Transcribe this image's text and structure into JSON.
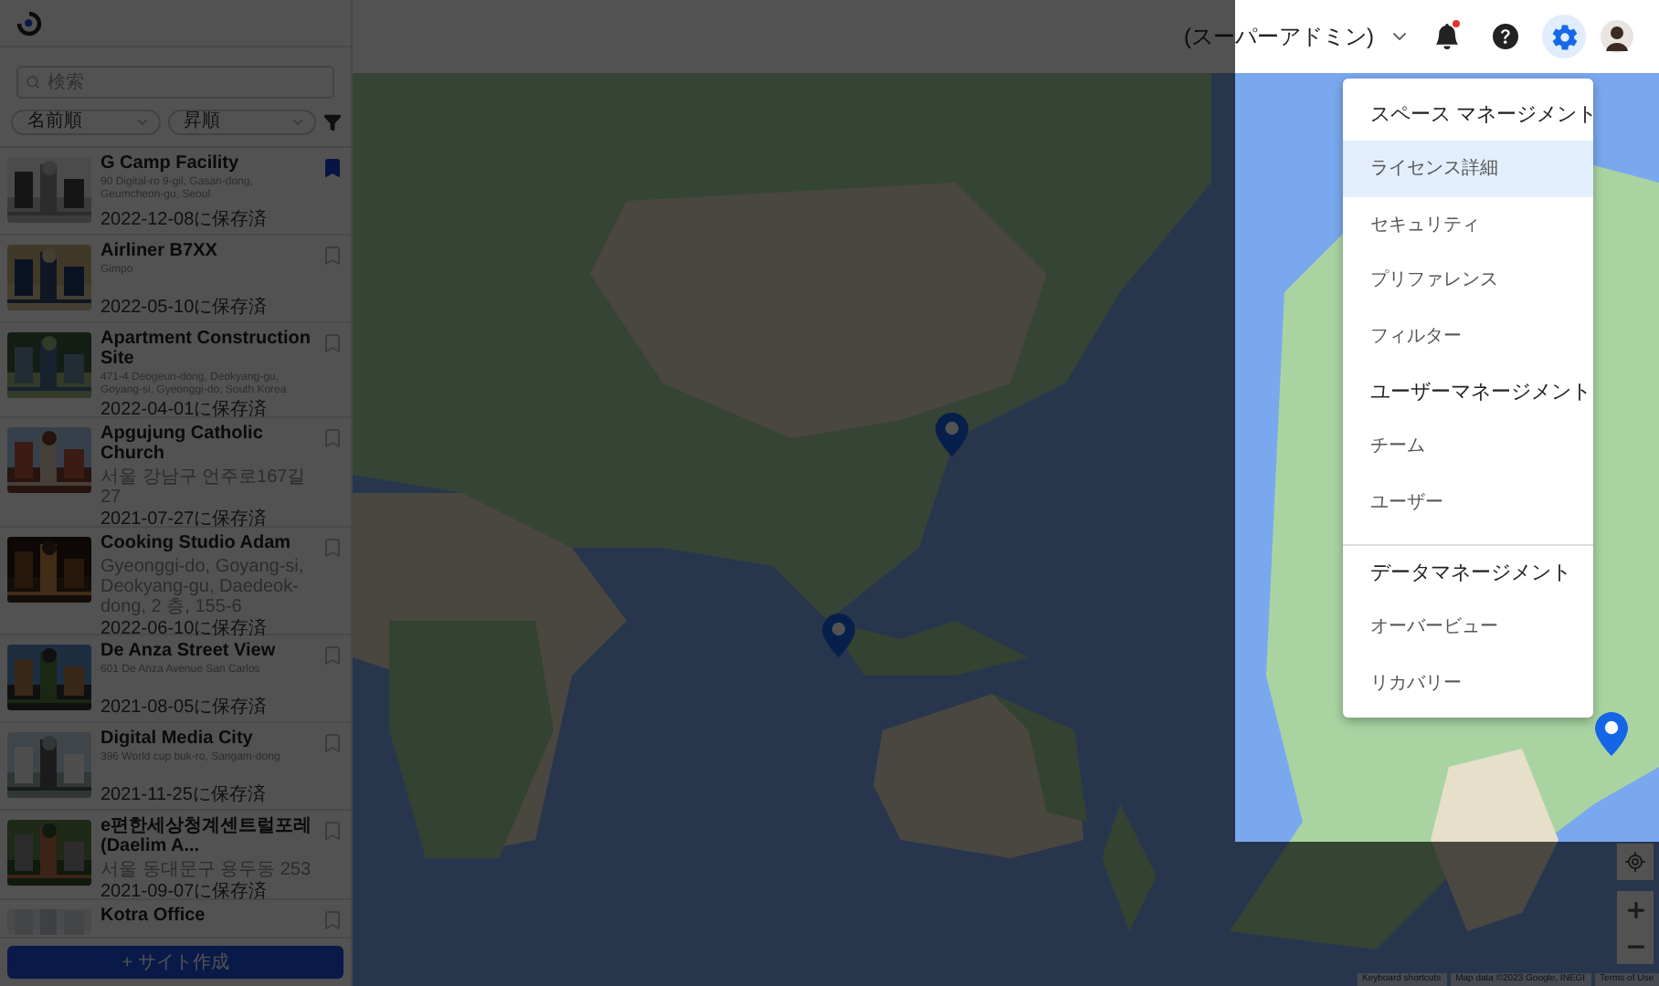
{
  "sidebar": {
    "search": {
      "placeholder": "検索"
    },
    "filters": [
      {
        "label": "名前順"
      },
      {
        "label": "昇順"
      }
    ],
    "sites": [
      {
        "title": "G Camp Facility",
        "address": "90 Digital-ro 9-gil, Gasan-dong, Geumcheon-gu, Seoul",
        "date": "2022-12-08に保存済",
        "bookmarked": true
      },
      {
        "title": "Airliner B7XX",
        "address": "Gimpo",
        "date": "2022-05-10に保存済",
        "bookmarked": false
      },
      {
        "title": "Apartment Construction Site",
        "address": "471-4 Deogeun-dong, Deokyang-gu, Goyang-si, Gyeonggi-do, South Korea",
        "date": "2022-04-01に保存済",
        "bookmarked": false
      },
      {
        "title": "Apgujung Catholic Church",
        "address": "서울 강남구 언주로167길 27",
        "date": "2021-07-27に保存済",
        "bookmarked": false
      },
      {
        "title": "Cooking Studio Adam",
        "address": "Gyeonggi-do, Goyang-si, Deokyang-gu, Daedeok-dong, 2 층, 155-6",
        "date": "2022-06-10に保存済",
        "bookmarked": false
      },
      {
        "title": "De Anza Street View",
        "address": "601 De Anza Avenue San Carlos",
        "date": "2021-08-05に保存済",
        "bookmarked": false
      },
      {
        "title": "Digital Media City",
        "address": "396 World cup buk-ro, Sangam-dong",
        "date": "2021-11-25に保存済",
        "bookmarked": false
      },
      {
        "title": "e편한세상청계센트럴포레 (Daelim A...",
        "address": "서울 동대문구 용두동 253",
        "date": "2021-09-07に保存済",
        "bookmarked": false
      },
      {
        "title": "Kotra Office",
        "bookmarked": false
      }
    ],
    "create_button": "+ サイト作成"
  },
  "header": {
    "role": "(スーパーアドミン)",
    "unread_notifications": true,
    "settings_open": true
  },
  "settings_menu": {
    "sections": [
      {
        "title": "スペース マネージメント",
        "divider": false,
        "items": [
          {
            "label": "ライセンス詳細",
            "selected": true
          },
          {
            "label": "セキュリティ",
            "selected": false
          },
          {
            "label": "プリファレンス",
            "selected": false
          },
          {
            "label": "フィルター",
            "selected": false
          }
        ]
      },
      {
        "title": "ユーザーマネージメント",
        "divider": false,
        "items": [
          {
            "label": "チーム",
            "selected": false
          },
          {
            "label": "ユーザー",
            "selected": false
          }
        ]
      },
      {
        "title": "データマネージメント",
        "divider": true,
        "items": [
          {
            "label": "オーバービュー",
            "selected": false
          },
          {
            "label": "リカバリー",
            "selected": false
          }
        ]
      }
    ]
  },
  "map": {
    "attribution": [
      "Keyboard shortcuts",
      "Map data ©2023 Google, INEGI",
      "Terms of Use"
    ]
  },
  "overlay": {
    "shown": true
  }
}
